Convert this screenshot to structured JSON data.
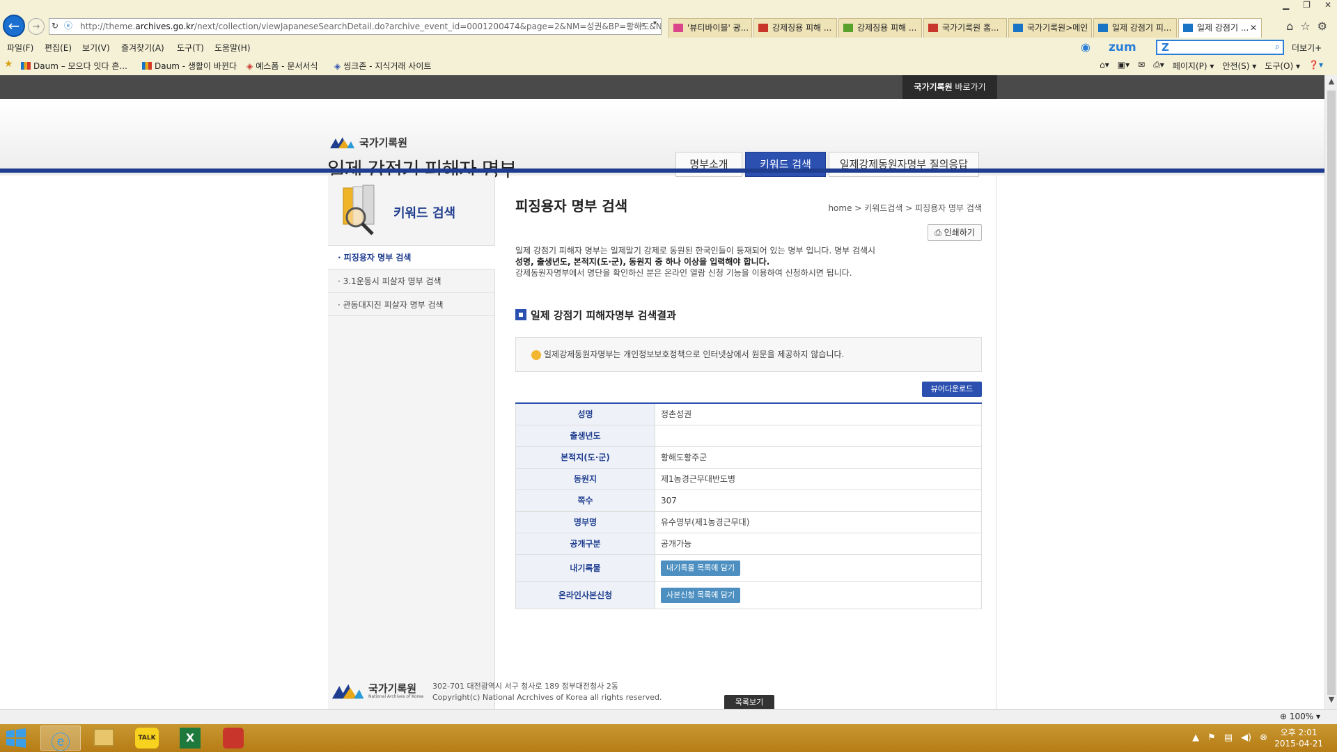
{
  "browser": {
    "url_prefix": "http://theme.",
    "url_domain": "archives.go.kr",
    "url_rest": "/next/collection/viewJapaneseSearchDetail.do?archive_event_id=0001200474&page=2&NM=성권&BP=황해도&NP=&sda",
    "tabs": [
      {
        "label": "'뷰티바이블' 광...",
        "color": "#d9468a"
      },
      {
        "label": "강제징용 피해 ...",
        "color": "#c8352a"
      },
      {
        "label": "강제징용 피해 ...",
        "color": "#5aa02c"
      },
      {
        "label": "국가기록원 홈...",
        "color": "#c8352a"
      },
      {
        "label": "국가기록원>메인",
        "color": "#1a74c6"
      },
      {
        "label": "일제 강점기 피...",
        "color": "#1a74c6"
      },
      {
        "label": "일제 강점기 ...",
        "color": "#1a74c6"
      }
    ],
    "menu": [
      "파일(F)",
      "편집(E)",
      "보기(V)",
      "즐겨찾기(A)",
      "도구(T)",
      "도움말(H)"
    ],
    "favorites": [
      "Daum – 모으다 잇다 흔...",
      "Daum - 생활이 바뀐다",
      "예스폼 - 문서서식",
      "씽크존 - 지식거래 사이트"
    ],
    "commands": [
      "페이지(P) ▾",
      "안전(S) ▾",
      "도구(O) ▾"
    ],
    "zum_logo": "zum",
    "zum_z": "Z",
    "more": "더보기+",
    "zoom": "100%"
  },
  "site": {
    "archive_link_bold": "국가기록원",
    "archive_link_rest": " 바로가기",
    "org_name": "국가기록원",
    "title": "일제 강점기 피해자 명부",
    "nav": [
      "명부소개",
      "키워드 검색",
      "일제강제동원자명부 질의응답"
    ]
  },
  "lnb": {
    "title": "키워드 검색",
    "items": [
      "· 피징용자 명부 검색",
      "· 3.1운동시 피살자 명부 검색",
      "· 관동대지진 피살자 명부 검색"
    ]
  },
  "main": {
    "heading": "피징용자 명부 검색",
    "breadcrumb": "home > 키워드검색 > 피징용자 명부 검색",
    "print": "인쇄하기",
    "intro_1": "일제 강점기 피해자 명부는 일제말기 강제로 동원된 한국인들이 등재되어 있는 명부 입니다. 명부 검색시",
    "intro_2": "성명, 출생년도, 본적지(도·군), 동원지 중 하나 이상을 입력해야 합니다.",
    "intro_3": "강제동원자명부에서 명단을 확인하신 분은 온라인 열람 신청 기능을 이용하여 신청하시면 됩니다.",
    "result_heading": "일제 강점기 피해자명부 검색결과",
    "notice": "일제강제동원자명부는 개인정보보호정책으로 인터넷상에서 원문을 제공하지 않습니다.",
    "viewer_download": "뷰어다운로드",
    "rows": [
      {
        "label": "성명",
        "value": "정촌성권"
      },
      {
        "label": "출생년도",
        "value": ""
      },
      {
        "label": "본적지(도·군)",
        "value": "황해도황주군"
      },
      {
        "label": "동원지",
        "value": "제1농경근무대반도병"
      },
      {
        "label": "쪽수",
        "value": "307"
      },
      {
        "label": "명부명",
        "value": "유수명부(제1농경근무대)"
      },
      {
        "label": "공개구분",
        "value": "공개가능"
      }
    ],
    "my_records_label": "내기록물",
    "my_records_btn": "내기록물 목록에 담기",
    "online_copy_label": "온라인사본신청",
    "online_copy_btn": "사본신청 목록에 담기",
    "list_btn": "목록보기"
  },
  "footer": {
    "org": "국가기록원",
    "org_en": "National Archives of Korea",
    "address": "302-701 대전광역시 서구 청사로 189 정부대전청사 2동",
    "copyright": "Copyright(c) National Acrchives of Korea all rights reserved."
  },
  "taskbar": {
    "kakao": "TALK",
    "time": "오후 2:01",
    "date": "2015-04-21"
  }
}
